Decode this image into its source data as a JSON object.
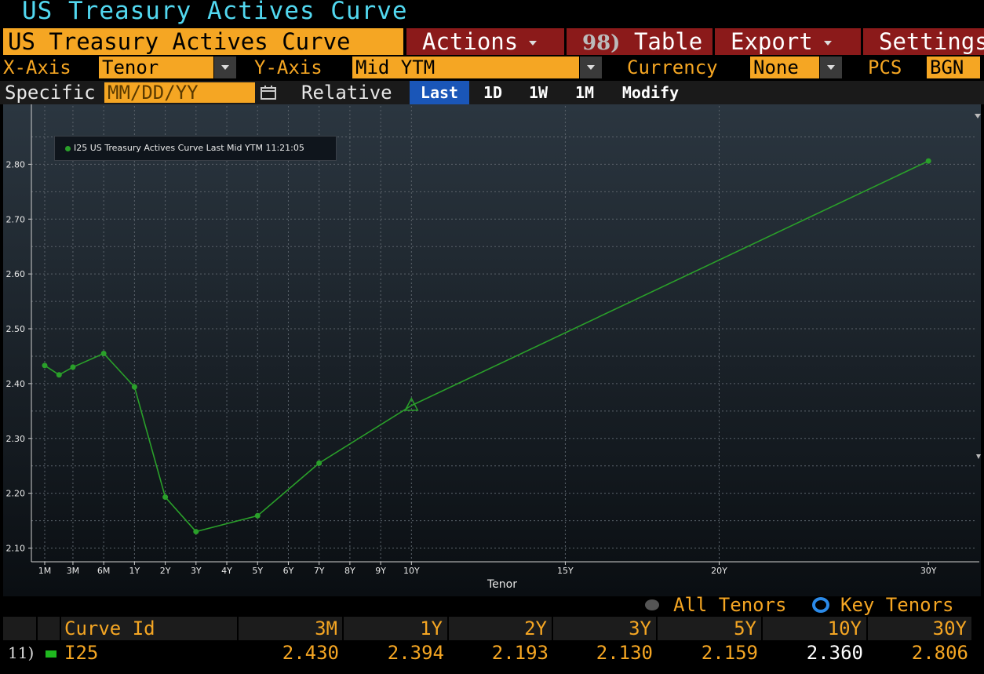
{
  "window": {
    "title": "US Treasury Actives Curve"
  },
  "toolbar": {
    "main_label": "US Treasury Actives Curve",
    "actions_label": "Actions",
    "table_num": "98)",
    "table_label": "Table",
    "export_label": "Export",
    "settings_label": "Settings"
  },
  "axes_row": {
    "x_axis_label": "X-Axis",
    "x_axis_value": "Tenor",
    "y_axis_label": "Y-Axis",
    "y_axis_value": "Mid YTM",
    "currency_label": "Currency",
    "currency_value": "None",
    "pcs_label": "PCS",
    "pcs_value": "BGN"
  },
  "date_row": {
    "specific_label": "Specific",
    "date_placeholder": "MM/DD/YY",
    "relative_label": "Relative",
    "buttons": [
      "Last",
      "1D",
      "1W",
      "1M",
      "Modify"
    ],
    "active_button": "Last"
  },
  "chart_data": {
    "type": "line",
    "legend": "I25 US Treasury Actives Curve Last Mid YTM 11:21:05",
    "legend_placement": "top-left",
    "xlabel": "Tenor",
    "ylabel": "",
    "x_scale": "years",
    "xlim": [
      -0.35,
      30.3
    ],
    "ylim": [
      2.075,
      2.895
    ],
    "grid": true,
    "yticks": [
      2.1,
      2.2,
      2.3,
      2.4,
      2.5,
      2.6,
      2.7,
      2.8
    ],
    "ytick_labels": [
      "2.10",
      "2.20",
      "2.30",
      "2.40",
      "2.50",
      "2.60",
      "2.70",
      "2.80"
    ],
    "xticks": [
      {
        "label": "1M",
        "years": 0.0833
      },
      {
        "label": "3M",
        "years": 1
      },
      {
        "label": "6M",
        "years": 2
      },
      {
        "label": "1Y",
        "years": 3
      },
      {
        "label": "2Y",
        "years": 4
      },
      {
        "label": "3Y",
        "years": 5
      },
      {
        "label": "4Y",
        "years": 6
      },
      {
        "label": "5Y",
        "years": 7
      },
      {
        "label": "6Y",
        "years": 8
      },
      {
        "label": "7Y",
        "years": 9
      },
      {
        "label": "8Y",
        "years": 10
      },
      {
        "label": "9Y",
        "years": 11
      },
      {
        "label": "10Y",
        "years": 12
      },
      {
        "label": "15Y",
        "years": 17
      },
      {
        "label": "20Y",
        "years": 22
      },
      {
        "label": "30Y",
        "years": 32
      }
    ],
    "series": [
      {
        "name": "I25",
        "color": "#2aa02a",
        "points": [
          {
            "tenor": "1M",
            "y": 2.433
          },
          {
            "tenor": "2M",
            "y": 2.416
          },
          {
            "tenor": "3M",
            "y": 2.43
          },
          {
            "tenor": "6M",
            "y": 2.455
          },
          {
            "tenor": "1Y",
            "y": 2.394
          },
          {
            "tenor": "2Y",
            "y": 2.193
          },
          {
            "tenor": "3Y",
            "y": 2.13
          },
          {
            "tenor": "5Y",
            "y": 2.159
          },
          {
            "tenor": "7Y",
            "y": 2.255
          },
          {
            "tenor": "10Y",
            "y": 2.36,
            "marker": "triangle"
          },
          {
            "tenor": "30Y",
            "y": 2.806
          }
        ]
      }
    ]
  },
  "toggles": {
    "all_tenors": "All Tenors",
    "key_tenors": "Key Tenors",
    "selected": "Key Tenors"
  },
  "table": {
    "headers": [
      "Curve Id",
      "3M",
      "1Y",
      "2Y",
      "3Y",
      "5Y",
      "10Y",
      "30Y"
    ],
    "rows": [
      {
        "num": "11)",
        "color": "#1fb81f",
        "id": "I25",
        "values": [
          "2.430",
          "2.394",
          "2.193",
          "2.130",
          "2.159",
          "2.360",
          "2.806"
        ]
      }
    ]
  }
}
